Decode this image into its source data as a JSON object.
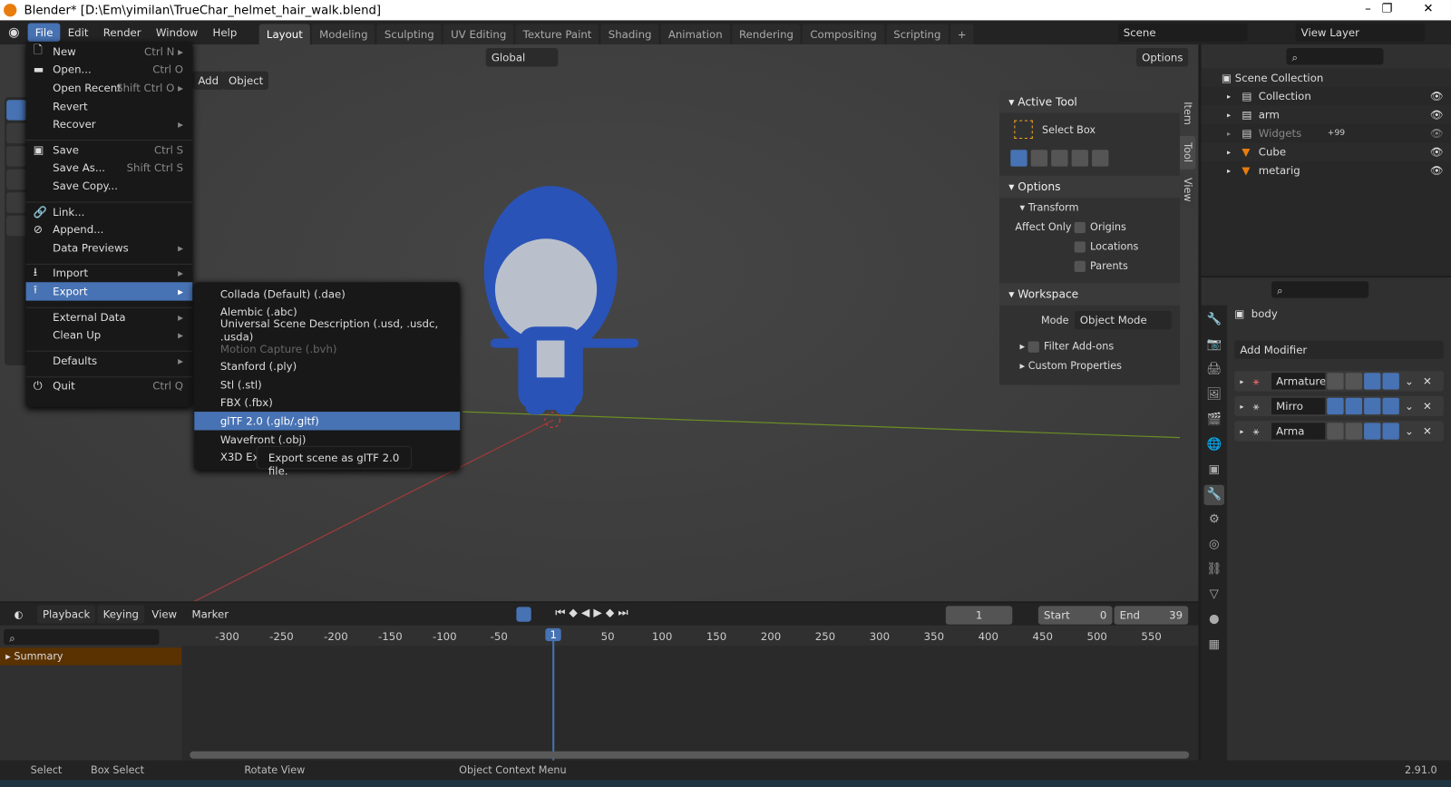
{
  "window": {
    "title": "Blender* [D:\\Em\\yimilan\\TrueChar_helmet_hair_walk.blend]",
    "controls": [
      "–",
      "❐",
      "✕"
    ]
  },
  "menubar": {
    "items": [
      "File",
      "Edit",
      "Render",
      "Window",
      "Help"
    ]
  },
  "workspaces": {
    "tabs": [
      "Layout",
      "Modeling",
      "Sculpting",
      "UV Editing",
      "Texture Paint",
      "Shading",
      "Animation",
      "Rendering",
      "Compositing",
      "Scripting",
      "+"
    ],
    "active": "Layout"
  },
  "scene": {
    "name": "Scene",
    "view_layer": "View Layer"
  },
  "viewport": {
    "add": "Add",
    "object": "Object",
    "orientation": "Global",
    "options": "Options"
  },
  "npanel": {
    "active_tool_title": "Active Tool",
    "tool_name": "Select Box",
    "options_title": "Options",
    "transform_title": "Transform",
    "affect_only": "Affect Only",
    "affect": [
      "Origins",
      "Locations",
      "Parents"
    ],
    "workspace_title": "Workspace",
    "mode_label": "Mode",
    "mode_value": "Object Mode",
    "filter_addons": "Filter Add-ons",
    "custom_props": "Custom Properties",
    "tabs": [
      "Item",
      "Tool",
      "View"
    ]
  },
  "outliner": {
    "root": "Scene Collection",
    "rows": [
      {
        "name": "Collection",
        "dim": false
      },
      {
        "name": "arm",
        "dim": false
      },
      {
        "name": "Widgets",
        "dim": true,
        "badge": "+99"
      },
      {
        "name": "Cube",
        "dim": false
      },
      {
        "name": "metarig",
        "dim": false
      }
    ]
  },
  "properties": {
    "object": "body",
    "add_modifier": "Add Modifier",
    "modifiers": [
      "Armature",
      "Mirro",
      "Arma"
    ]
  },
  "file_menu": {
    "items": [
      {
        "label": "New",
        "shortcut": "Ctrl N ▸",
        "icon": "🗋"
      },
      {
        "label": "Open...",
        "shortcut": "Ctrl O",
        "icon": "▬"
      },
      {
        "label": "Open Recent",
        "shortcut": "Shift Ctrl O ▸",
        "icon": ""
      },
      {
        "label": "Revert",
        "shortcut": "",
        "icon": ""
      },
      {
        "label": "Recover",
        "shortcut": "▸",
        "icon": ""
      },
      {
        "sep": true
      },
      {
        "label": "Save",
        "shortcut": "Ctrl S",
        "icon": "▣"
      },
      {
        "label": "Save As...",
        "shortcut": "Shift Ctrl S",
        "icon": ""
      },
      {
        "label": "Save Copy...",
        "shortcut": "",
        "icon": ""
      },
      {
        "sep": true
      },
      {
        "label": "Link...",
        "shortcut": "",
        "icon": "🔗"
      },
      {
        "label": "Append...",
        "shortcut": "",
        "icon": "⊘"
      },
      {
        "label": "Data Previews",
        "shortcut": "▸",
        "icon": ""
      },
      {
        "sep": true
      },
      {
        "label": "Import",
        "shortcut": "▸",
        "icon": "⭳"
      },
      {
        "label": "Export",
        "shortcut": "▸",
        "icon": "⭱",
        "highlight": true
      },
      {
        "sep": true
      },
      {
        "label": "External Data",
        "shortcut": "▸",
        "icon": ""
      },
      {
        "label": "Clean Up",
        "shortcut": "▸",
        "icon": ""
      },
      {
        "sep": true
      },
      {
        "label": "Defaults",
        "shortcut": "▸",
        "icon": ""
      },
      {
        "sep": true
      },
      {
        "label": "Quit",
        "shortcut": "Ctrl Q",
        "icon": "⏻"
      }
    ]
  },
  "export_menu": {
    "items": [
      {
        "label": "Collada (Default) (.dae)"
      },
      {
        "label": "Alembic (.abc)"
      },
      {
        "label": "Universal Scene Description (.usd, .usdc, .usda)"
      },
      {
        "label": "Motion Capture (.bvh)",
        "disabled": true
      },
      {
        "label": "Stanford (.ply)"
      },
      {
        "label": "Stl (.stl)"
      },
      {
        "label": "FBX (.fbx)"
      },
      {
        "label": "glTF 2.0 (.glb/.gltf)",
        "highlight": true
      },
      {
        "label": "Wavefront (.obj)"
      },
      {
        "label": "X3D Ext"
      }
    ]
  },
  "tooltip": "Export scene as glTF 2.0 file.",
  "timeline": {
    "menus": [
      "Playback",
      "Keying",
      "View",
      "Marker"
    ],
    "current_frame": "1",
    "start_label": "Start",
    "start": "0",
    "end_label": "End",
    "end": "39",
    "ticks": [
      "-300",
      "-250",
      "-200",
      "-150",
      "-100",
      "-50",
      "1",
      "50",
      "100",
      "150",
      "200",
      "250",
      "300",
      "350",
      "400",
      "450",
      "500",
      "550"
    ],
    "summary": "Summary"
  },
  "status": {
    "items": [
      "Select",
      "Box Select",
      "Rotate View",
      "Object Context Menu"
    ],
    "version": "2.91.0"
  },
  "colors": {
    "accent": "#4772b3",
    "orange": "#e87d0d",
    "green": "#27b08a"
  }
}
